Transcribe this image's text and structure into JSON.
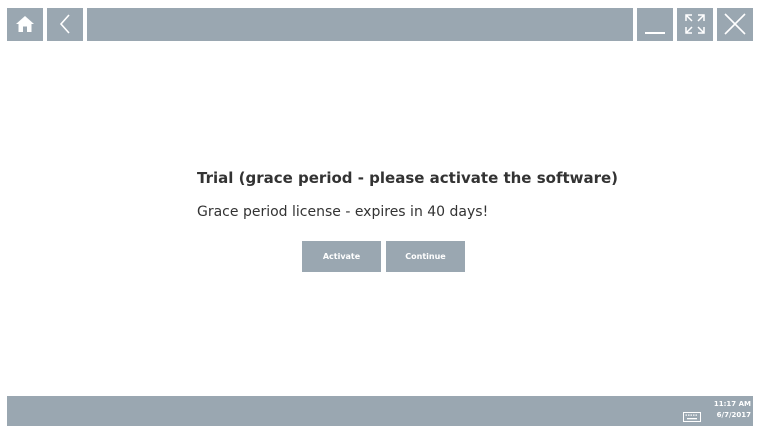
{
  "toolbar": {
    "home_icon": "home-icon",
    "back_icon": "chevron-left-icon",
    "minimize_icon": "minimize-icon",
    "maximize_icon": "maximize-icon",
    "close_icon": "close-icon",
    "bar_color": "#9aa7b1",
    "icon_color": "#ffffff"
  },
  "dialog": {
    "title": "Trial (grace period - please activate the software)",
    "message": "Grace period license - expires in 40 days!",
    "buttons": [
      {
        "label": "Activate"
      },
      {
        "label": "Continue"
      }
    ]
  },
  "taskbar": {
    "keyboard_icon": "keyboard-icon",
    "time": "11:17 AM",
    "date": "6/7/2017"
  }
}
